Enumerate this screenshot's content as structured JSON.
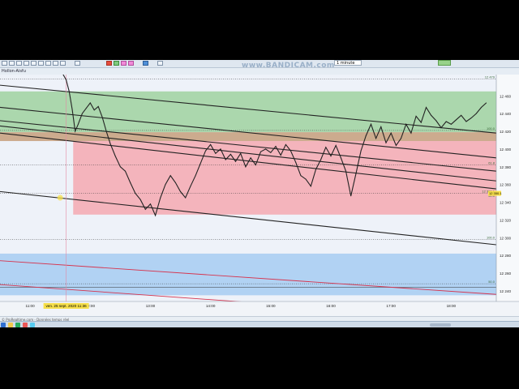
{
  "app": {
    "watermark": "www.BANDICAM.com",
    "chart_title": "Hollon-Aisfu",
    "period_value": "1 minute",
    "footer_credit": "© ProRealtime.com - Données temps réel",
    "crosshair_date": "ven. 25 sept. 2020 11:36"
  },
  "colors": {
    "green_zone": "#9fd2a0",
    "pink_zone": "#f4a9b1",
    "brown_zone": "#c69f7b",
    "blue_zone": "#a6cdf2",
    "price_line": "#222222",
    "red_trendline": "#d6344e",
    "axis_highlight": "#f7e04b"
  },
  "icons": [
    "zoom-in-icon",
    "zoom-out-icon",
    "cursor-icon",
    "trendline-icon",
    "text-icon",
    "fibonacci-icon",
    "rectangle-icon",
    "alert-icon",
    "indicator-icon",
    "settings-icon",
    "color-icon",
    "camera-icon"
  ],
  "chart_data": {
    "type": "line",
    "x_ticks": [
      "11:00",
      "12:00",
      "13:00",
      "14:00",
      "15:00",
      "16:00",
      "17:00",
      "18:00"
    ],
    "y_ticks": [
      "12 460",
      "12 440",
      "12 420",
      "12 400",
      "12 380",
      "12 360",
      "12 340",
      "12 320",
      "12 300",
      "12 280",
      "12 260",
      "12 240"
    ],
    "ylim": [
      12228,
      12484
    ],
    "right_labels": [
      {
        "text": "12 479",
        "y": 12479
      },
      {
        "text": "51.4",
        "y": 12483
      },
      {
        "text": "100.0",
        "y": 12421
      },
      {
        "text": "61.8",
        "y": 12382
      },
      {
        "text": "12 350.1",
        "y": 12350
      },
      {
        "text": "50.0",
        "y": 12345
      },
      {
        "text": "100.0",
        "y": 12298
      },
      {
        "text": "50.0",
        "y": 12248
      }
    ],
    "zones": [
      {
        "name": "green",
        "y_top": 12465,
        "y_bottom": 12419,
        "x_start": "10:30",
        "x_end": "18:45"
      },
      {
        "name": "brown",
        "y_top": 12419,
        "y_bottom": 12409,
        "x_start": "10:30",
        "x_end": "18:45"
      },
      {
        "name": "pink",
        "y_top": 12409,
        "y_bottom": 12326,
        "x_start": "11:43",
        "x_end": "18:45"
      },
      {
        "name": "blue",
        "y_top": 12282,
        "y_bottom": 12235,
        "x_start": "10:30",
        "x_end": "18:45"
      }
    ],
    "price": [
      [
        "11:33",
        12484
      ],
      [
        "11:36",
        12478
      ],
      [
        "11:39",
        12465
      ],
      [
        "11:42",
        12445
      ],
      [
        "11:45",
        12420
      ],
      [
        "11:48",
        12428
      ],
      [
        "11:52",
        12440
      ],
      [
        "11:56",
        12446
      ],
      [
        "12:00",
        12452
      ],
      [
        "12:04",
        12444
      ],
      [
        "12:08",
        12448
      ],
      [
        "12:12",
        12436
      ],
      [
        "12:16",
        12420
      ],
      [
        "12:20",
        12406
      ],
      [
        "12:25",
        12392
      ],
      [
        "12:30",
        12380
      ],
      [
        "12:35",
        12375
      ],
      [
        "12:40",
        12362
      ],
      [
        "12:45",
        12350
      ],
      [
        "12:50",
        12343
      ],
      [
        "12:55",
        12332
      ],
      [
        "13:00",
        12338
      ],
      [
        "13:05",
        12325
      ],
      [
        "13:10",
        12345
      ],
      [
        "13:15",
        12360
      ],
      [
        "13:20",
        12370
      ],
      [
        "13:25",
        12362
      ],
      [
        "13:30",
        12352
      ],
      [
        "13:35",
        12345
      ],
      [
        "13:40",
        12358
      ],
      [
        "13:45",
        12370
      ],
      [
        "13:50",
        12384
      ],
      [
        "13:55",
        12398
      ],
      [
        "14:00",
        12405
      ],
      [
        "14:05",
        12395
      ],
      [
        "14:10",
        12400
      ],
      [
        "14:15",
        12388
      ],
      [
        "14:20",
        12394
      ],
      [
        "14:25",
        12386
      ],
      [
        "14:30",
        12395
      ],
      [
        "14:35",
        12380
      ],
      [
        "14:40",
        12390
      ],
      [
        "14:45",
        12382
      ],
      [
        "14:50",
        12397
      ],
      [
        "14:55",
        12400
      ],
      [
        "15:00",
        12396
      ],
      [
        "15:05",
        12403
      ],
      [
        "15:10",
        12393
      ],
      [
        "15:15",
        12405
      ],
      [
        "15:20",
        12398
      ],
      [
        "15:25",
        12385
      ],
      [
        "15:30",
        12370
      ],
      [
        "15:35",
        12366
      ],
      [
        "15:40",
        12358
      ],
      [
        "15:45",
        12377
      ],
      [
        "15:50",
        12388
      ],
      [
        "15:55",
        12402
      ],
      [
        "16:00",
        12392
      ],
      [
        "16:05",
        12404
      ],
      [
        "16:10",
        12390
      ],
      [
        "16:15",
        12375
      ],
      [
        "16:20",
        12347
      ],
      [
        "16:25",
        12372
      ],
      [
        "16:30",
        12398
      ],
      [
        "16:35",
        12415
      ],
      [
        "16:40",
        12428
      ],
      [
        "16:45",
        12412
      ],
      [
        "16:50",
        12425
      ],
      [
        "16:55",
        12407
      ],
      [
        "17:00",
        12418
      ],
      [
        "17:05",
        12404
      ],
      [
        "17:10",
        12412
      ],
      [
        "17:15",
        12428
      ],
      [
        "17:20",
        12418
      ],
      [
        "17:25",
        12437
      ],
      [
        "17:30",
        12430
      ],
      [
        "17:35",
        12447
      ],
      [
        "17:40",
        12438
      ],
      [
        "17:45",
        12432
      ],
      [
        "17:50",
        12424
      ],
      [
        "17:55",
        12431
      ],
      [
        "18:00",
        12428
      ],
      [
        "18:05",
        12433
      ],
      [
        "18:10",
        12438
      ],
      [
        "18:15",
        12431
      ],
      [
        "18:20",
        12435
      ],
      [
        "18:25",
        12440
      ],
      [
        "18:30",
        12447
      ],
      [
        "18:35",
        12452
      ]
    ],
    "trendlines": [
      {
        "color": "black",
        "p1": [
          "10:30",
          12472
        ],
        "p2": [
          "18:45",
          12418
        ]
      },
      {
        "color": "black",
        "p1": [
          "10:30",
          12447
        ],
        "p2": [
          "18:45",
          12390
        ]
      },
      {
        "color": "black",
        "p1": [
          "10:30",
          12432
        ],
        "p2": [
          "18:45",
          12375
        ]
      },
      {
        "color": "black",
        "p1": [
          "10:30",
          12426
        ],
        "p2": [
          "18:45",
          12364
        ]
      },
      {
        "color": "black",
        "p1": [
          "10:30",
          12418
        ],
        "p2": [
          "18:45",
          12355
        ]
      },
      {
        "color": "black",
        "p1": [
          "10:30",
          12352
        ],
        "p2": [
          "18:45",
          12292
        ]
      },
      {
        "color": "red",
        "p1": [
          "10:30",
          12274
        ],
        "p2": [
          "18:45",
          12236
        ]
      },
      {
        "color": "red",
        "p1": [
          "10:30",
          12247
        ],
        "p2": [
          "16:30",
          12218
        ]
      }
    ],
    "hlines": [
      {
        "style": "dotted",
        "y": 12479
      },
      {
        "style": "dotted",
        "y": 12421
      },
      {
        "style": "dotted",
        "y": 12382
      },
      {
        "style": "dotted",
        "y": 12350
      },
      {
        "style": "dotted",
        "y": 12298
      },
      {
        "style": "dotted",
        "y": 12248
      },
      {
        "style": "solid",
        "y": 12244
      }
    ],
    "crosshair_x": "11:36"
  }
}
